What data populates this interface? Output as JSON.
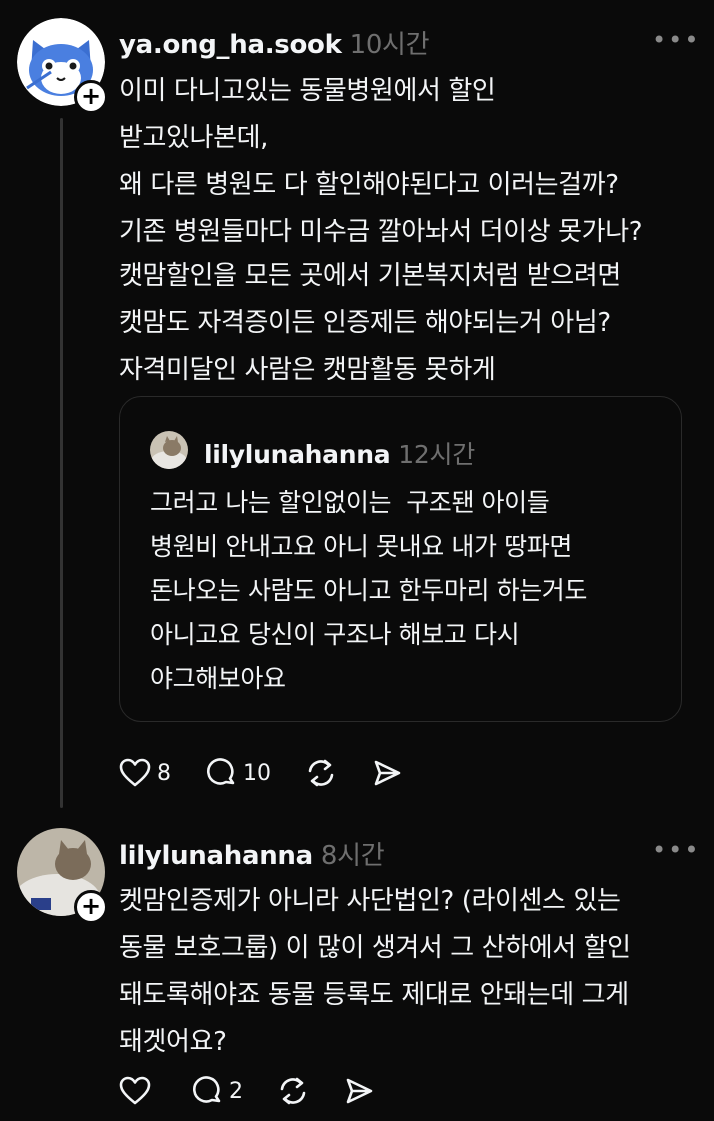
{
  "post1": {
    "username": "ya.ong_ha.sook",
    "time": "10시간",
    "more": "•••",
    "text": "이미 다니고있는 동물병원에서 할인\n받고있나본데,\n왜 다른 병원도 다 할인해야된다고 이러는걸까?\n기존 병원들마다 미수금 깔아놔서 더이상 못가나?",
    "text2": "캣맘할인을 모든 곳에서 기본복지처럼 받으려면\n캣맘도 자격증이든 인증제든 해야되는거 아님?\n자격미달인 사람은 캣맘활동 못하게",
    "quote": {
      "username": "lilylunahanna",
      "time": "12시간",
      "text": "그러고 나는 할인없이는  구조됀 아이들\n병원비 안내고요 아니 못내요 내가 땅파면\n돈나오는 사람도 아니고 한두마리 하는거도\n아니고요 당신이 구조나 해보고 다시\n야그해보아요"
    },
    "likes": "8",
    "replies": "10"
  },
  "post2": {
    "username": "lilylunahanna",
    "time": "8시간",
    "more": "•••",
    "text": "켓맘인증제가 아니라 사단법인? (라이센스 있는\n동물 보호그룹) 이 많이 생겨서 그 산하에서 할인\n돼도록해야죠 동물 등록도 제대로 안돼는데 그게\n돼겟어요?",
    "likes": "",
    "replies": "2"
  },
  "colors": {
    "background": "#0a0a0a",
    "text": "#f3f5f7",
    "muted": "#6f6f6f",
    "border": "#2a2a2a"
  },
  "icons": [
    "heart-icon",
    "comment-icon",
    "repost-icon",
    "share-icon",
    "plus-icon",
    "more-icon"
  ]
}
